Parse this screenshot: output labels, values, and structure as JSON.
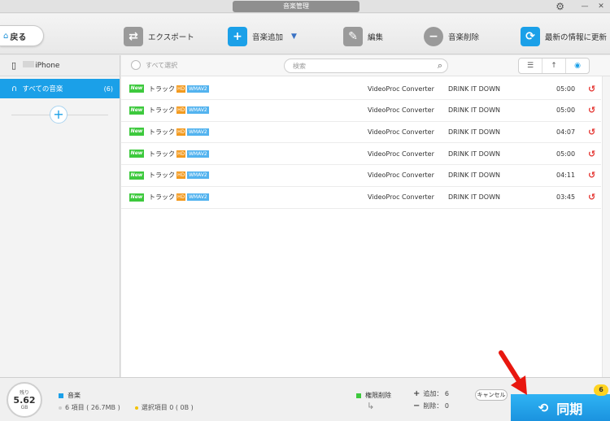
{
  "window": {
    "title": "音楽管理",
    "minimize": "—",
    "close": "✕"
  },
  "toolbar": {
    "back_label": "戻る",
    "export_label": "エクスポート",
    "add_label": "音楽追加",
    "edit_label": "編集",
    "delete_label": "音楽削除",
    "refresh_label": "最新の情報に更新"
  },
  "sidebar": {
    "device_name": "iPhone",
    "all_music_label": "すべての音楽",
    "all_music_count": "(6)"
  },
  "list": {
    "select_all": "すべて選択",
    "search_placeholder": "検索",
    "tracks": [
      {
        "badge": "New",
        "name": "トラック 1",
        "hd": "HD",
        "format": "WMAV2",
        "artist": "VideoProc Converter",
        "album": "DRINK IT DOWN",
        "duration": "05:00"
      },
      {
        "badge": "New",
        "name": "トラック 2",
        "hd": "HD",
        "format": "WMAV2",
        "artist": "VideoProc Converter",
        "album": "DRINK IT DOWN",
        "duration": "05:00"
      },
      {
        "badge": "New",
        "name": "トラック 3",
        "hd": "HD",
        "format": "WMAV2",
        "artist": "VideoProc Converter",
        "album": "DRINK IT DOWN",
        "duration": "04:07"
      },
      {
        "badge": "New",
        "name": "トラック 4",
        "hd": "HD",
        "format": "WMAV2",
        "artist": "VideoProc Converter",
        "album": "DRINK IT DOWN",
        "duration": "05:00"
      },
      {
        "badge": "New",
        "name": "トラック 5",
        "hd": "HD",
        "format": "WMAV2",
        "artist": "VideoProc Converter",
        "album": "DRINK IT DOWN",
        "duration": "04:11"
      },
      {
        "badge": "New",
        "name": "トラック 6",
        "hd": "HD",
        "format": "WMAV2",
        "artist": "VideoProc Converter",
        "album": "DRINK IT DOWN",
        "duration": "03:45"
      }
    ]
  },
  "footer": {
    "remaining_label": "残り",
    "remaining_value": "5.62",
    "remaining_unit": "GB",
    "music_label": "音楽",
    "items_text": "6 項目 ( 26.7MB )",
    "selected_text": "選択項目 0 ( 0B )",
    "perm_delete_label": "権限削除",
    "add_text": "追加： 6",
    "delete_text": "削除： 0",
    "cancel_label": "キャンセル",
    "sync_label": "同期",
    "sync_badge": "6"
  },
  "colors": {
    "accent": "#1ba0e8",
    "new_badge": "#3dc93d",
    "hd_badge": "#f39a1e",
    "format_badge": "#53b3ef",
    "undo": "#e53935",
    "sync_badge": "#ffd321",
    "pointer_arrow": "#e8170f"
  },
  "icons": [
    "settings-gear-icon",
    "home-icon",
    "export-icon",
    "headphones-add-icon",
    "edit-icon",
    "headphones-remove-icon",
    "refresh-icon",
    "phone-icon",
    "headphones-icon",
    "add-icon",
    "search-icon",
    "list-view-icon",
    "sort-icon",
    "disc-icon",
    "undo-icon",
    "sync-icon",
    "arrow-pointer-icon"
  ]
}
